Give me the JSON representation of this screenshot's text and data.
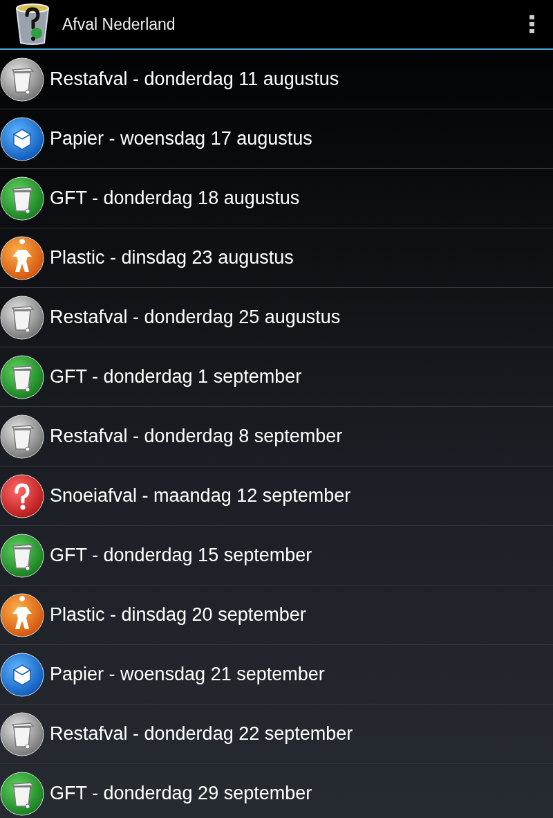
{
  "app_bar": {
    "title": "Afval Nederland"
  },
  "pickups": [
    {
      "kind": "rest",
      "text": "Restafval - donderdag 11 augustus"
    },
    {
      "kind": "paper",
      "text": "Papier - woensdag 17 augustus"
    },
    {
      "kind": "gft",
      "text": "GFT - donderdag 18 augustus"
    },
    {
      "kind": "plastic",
      "text": "Plastic - dinsdag 23 augustus"
    },
    {
      "kind": "rest",
      "text": "Restafval - donderdag 25 augustus"
    },
    {
      "kind": "gft",
      "text": "GFT - donderdag 1 september"
    },
    {
      "kind": "rest",
      "text": "Restafval - donderdag 8 september"
    },
    {
      "kind": "pruning",
      "text": "Snoeiafval - maandag 12 september"
    },
    {
      "kind": "gft",
      "text": "GFT - donderdag 15 september"
    },
    {
      "kind": "plastic",
      "text": "Plastic - dinsdag 20 september"
    },
    {
      "kind": "paper",
      "text": "Papier - woensdag 21 september"
    },
    {
      "kind": "rest",
      "text": "Restafval - donderdag 22 september"
    },
    {
      "kind": "gft",
      "text": "GFT - donderdag 29 september"
    }
  ]
}
